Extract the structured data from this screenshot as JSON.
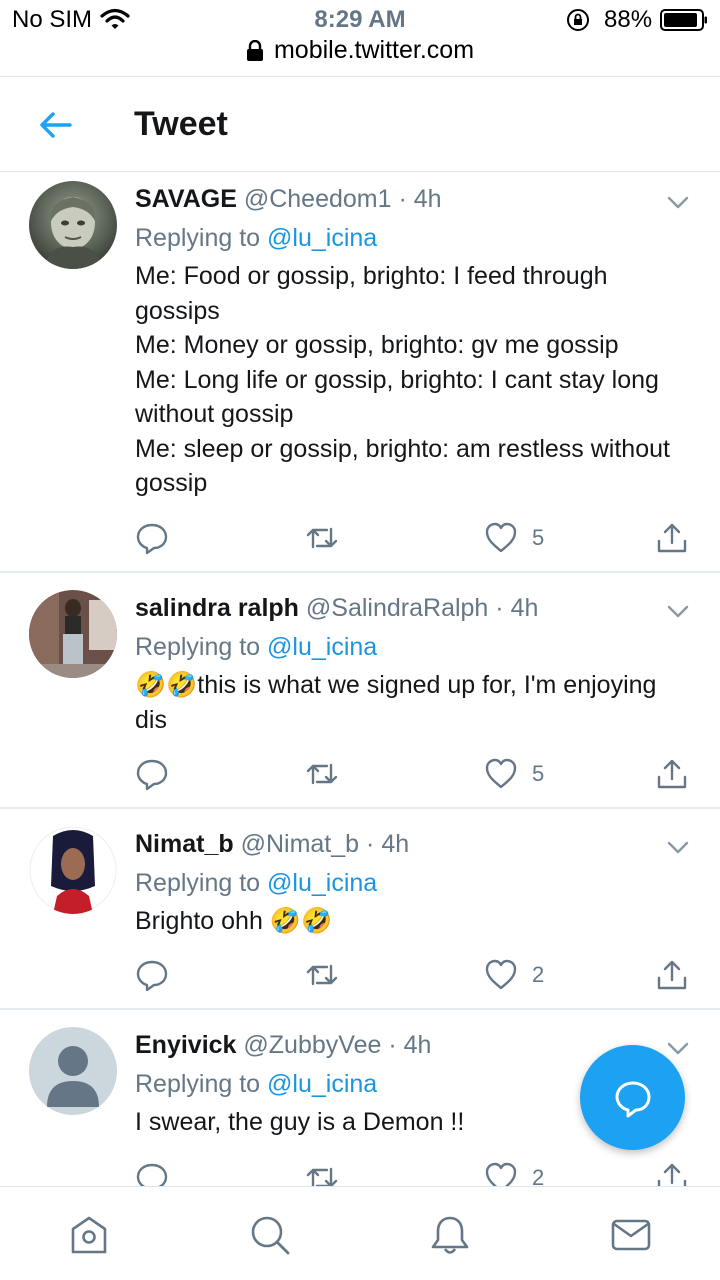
{
  "status_bar": {
    "carrier": "No SIM",
    "time": "8:29 AM",
    "battery": "88%"
  },
  "browser": {
    "url": "mobile.twitter.com"
  },
  "header": {
    "title": "Tweet"
  },
  "tweets": [
    {
      "name": "SAVAGE",
      "handle": "@Cheedom1",
      "time": "4h",
      "replying_label": "Replying to",
      "replying_to": "@lu_icina",
      "text": "Me: Food or gossip, brighto: I feed through gossips\nMe: Money or gossip, brighto: gv me gossip\nMe: Long life or gossip, brighto: I cant stay long without gossip\nMe: sleep or gossip, brighto: am restless without gossip",
      "likes": "5"
    },
    {
      "name": "salindra ralph",
      "handle": "@SalindraRalph",
      "time": "4h",
      "replying_label": "Replying to",
      "replying_to": "@lu_icina",
      "text": "🤣🤣this is what we signed up for, I'm enjoying dis",
      "likes": "5"
    },
    {
      "name": "Nimat_b",
      "handle": "@Nimat_b",
      "time": "4h",
      "replying_label": "Replying to",
      "replying_to": "@lu_icina",
      "text": "Brighto ohh 🤣🤣",
      "likes": "2"
    },
    {
      "name": "Enyivick",
      "handle": "@ZubbyVee",
      "time": "4h",
      "replying_label": "Replying to",
      "replying_to": "@lu_icina",
      "text": "I swear, the guy is a Demon !!",
      "likes": "2"
    }
  ],
  "colors": {
    "accent": "#1da1f2",
    "link": "#1b95e0",
    "muted": "#657786",
    "text": "#14171a"
  },
  "icons": {
    "header": "back-arrow-icon",
    "actions": [
      "reply-icon",
      "retweet-icon",
      "like-icon",
      "share-icon"
    ],
    "fab": "compose-reply-icon",
    "tabs": [
      "home-icon",
      "search-icon",
      "notifications-icon",
      "messages-icon"
    ]
  }
}
